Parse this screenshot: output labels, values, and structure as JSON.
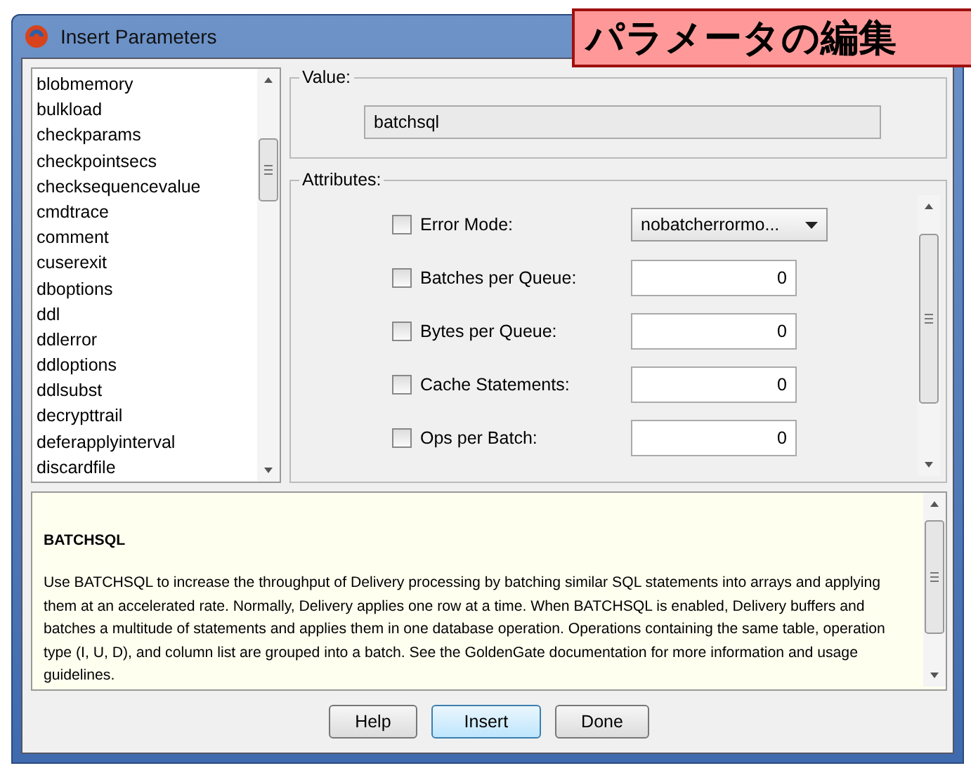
{
  "window": {
    "title": "Insert Parameters"
  },
  "banner": {
    "text": "パラメータの編集"
  },
  "parameters": [
    {
      "name": "blobmemory",
      "selected": false
    },
    {
      "name": "bulkload",
      "selected": false
    },
    {
      "name": "checkparams",
      "selected": false
    },
    {
      "name": "checkpointsecs",
      "selected": false
    },
    {
      "name": "checksequencevalue",
      "selected": false
    },
    {
      "name": "cmdtrace",
      "selected": false
    },
    {
      "name": "comment",
      "selected": false
    },
    {
      "name": "cuserexit",
      "selected": false
    },
    {
      "name": "dboptions",
      "selected": false
    },
    {
      "name": "ddl",
      "selected": false
    },
    {
      "name": "ddlerror",
      "selected": false
    },
    {
      "name": "ddloptions",
      "selected": false
    },
    {
      "name": "ddlsubst",
      "selected": false
    },
    {
      "name": "decrypttrail",
      "selected": false
    },
    {
      "name": "deferapplyinterval",
      "selected": false
    },
    {
      "name": "discardfile",
      "selected": false
    }
  ],
  "value": {
    "label": "Value:",
    "text": "batchsql"
  },
  "attributes": {
    "label": "Attributes:",
    "rows": [
      {
        "kind": "dropdown",
        "label": "Error Mode:",
        "checked": false,
        "value": "nobatcherrormo..."
      },
      {
        "kind": "number",
        "label": "Batches per Queue:",
        "checked": false,
        "value": "0"
      },
      {
        "kind": "number",
        "label": "Bytes per Queue:",
        "checked": false,
        "value": "0"
      },
      {
        "kind": "number",
        "label": "Cache Statements:",
        "checked": false,
        "value": "0"
      },
      {
        "kind": "number",
        "label": "Ops per Batch:",
        "checked": false,
        "value": "0"
      }
    ]
  },
  "description": {
    "title": "BATCHSQL",
    "body": "Use BATCHSQL to increase the throughput of Delivery processing by batching similar SQL statements into arrays and applying them at an accelerated rate. Normally, Delivery applies one row at a time. When BATCHSQL is enabled, Delivery buffers and batches a multitude of statements and applies them in one database operation. Operations containing the same table, operation type (I, U, D), and column list are grouped into a batch. See the GoldenGate documentation for more information and usage guidelines."
  },
  "buttons": [
    {
      "label": "Help",
      "selected": false
    },
    {
      "label": "Insert",
      "selected": true
    },
    {
      "label": "Done",
      "selected": false
    }
  ]
}
